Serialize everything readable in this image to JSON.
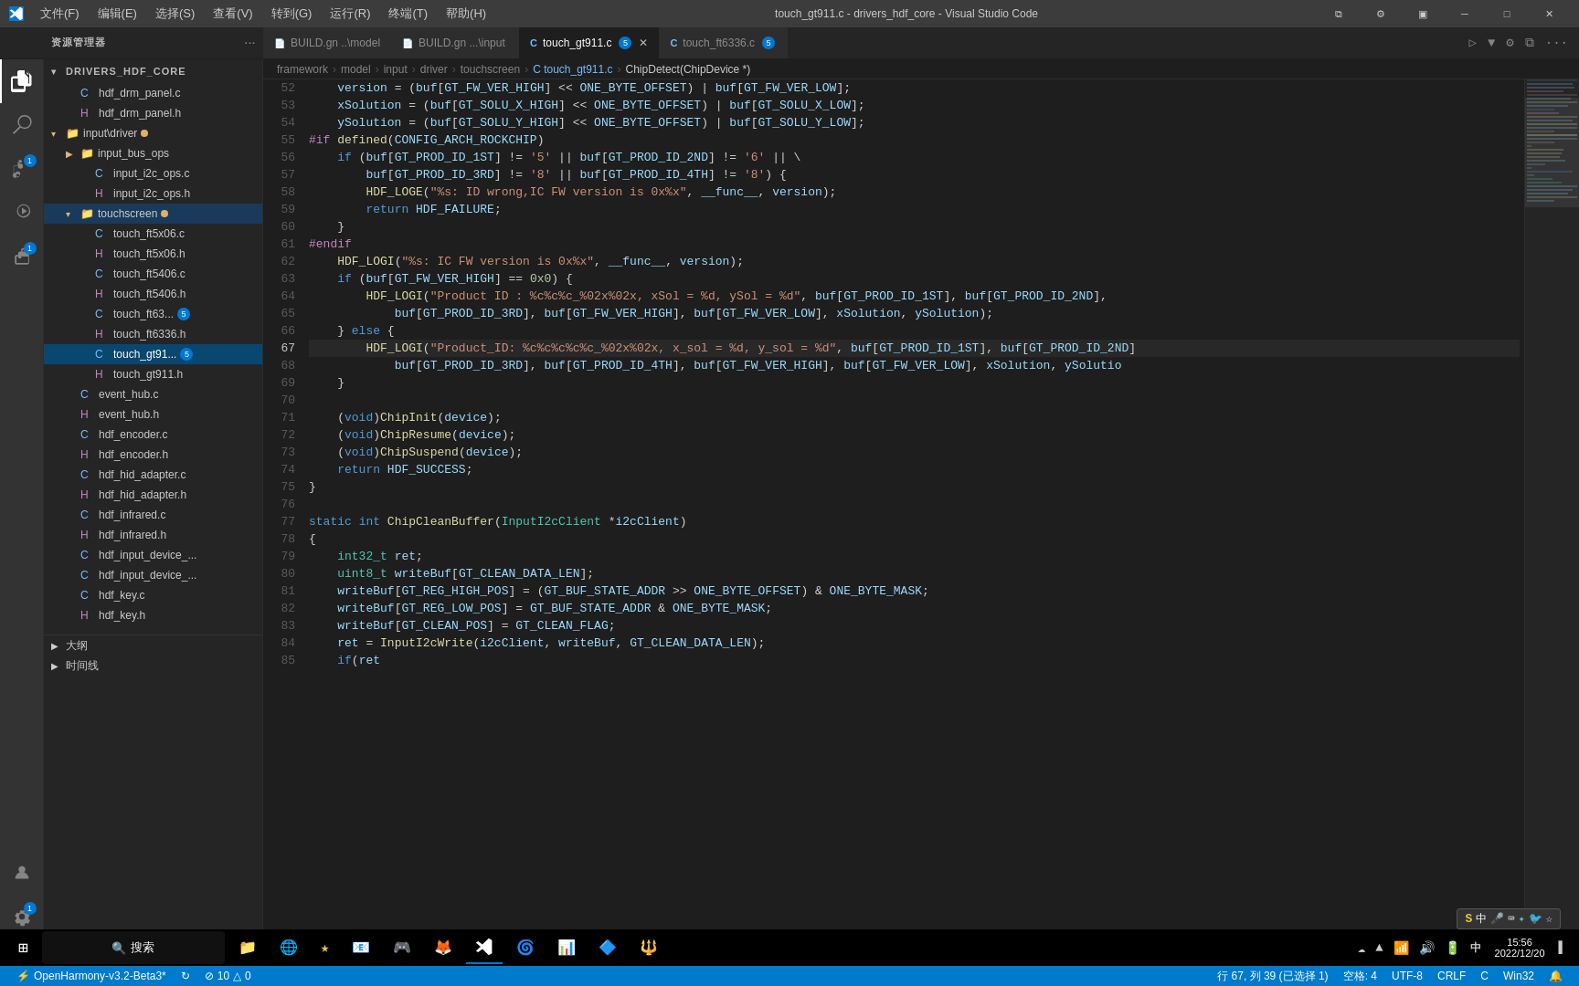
{
  "titlebar": {
    "title": "touch_gt911.c - drivers_hdf_core - Visual Studio Code",
    "icon": "VS",
    "menu": [
      "文件(F)",
      "编辑(E)",
      "选择(S)",
      "查看(V)",
      "转到(G)",
      "运行(R)",
      "终端(T)",
      "帮助(H)"
    ]
  },
  "tabs": [
    {
      "id": "build-gn-model",
      "label": "BUILD.gn  ..\\model",
      "icon": "📄",
      "active": false
    },
    {
      "id": "build-gn-input",
      "label": "BUILD.gn  ...\\input",
      "icon": "📄",
      "active": false
    },
    {
      "id": "touch-gt911",
      "label": "touch_gt911.c",
      "icon": "C",
      "active": true,
      "badge": "5",
      "closable": true
    },
    {
      "id": "touch-ft6336",
      "label": "touch_ft6336.c",
      "icon": "C",
      "active": false,
      "badge": "5",
      "closable": false
    }
  ],
  "breadcrumb": {
    "items": [
      "framework",
      "model",
      "input",
      "driver",
      "touchscreen",
      "C touch_gt911.c",
      "ChipDetect(ChipDevice *)"
    ]
  },
  "sidebar": {
    "title": "资源管理器",
    "root": "DRIVERS_HDF_CORE",
    "tree": [
      {
        "level": 1,
        "type": "folder",
        "name": "hdf_drm_panel.c",
        "indent": 1
      },
      {
        "level": 1,
        "type": "file-h",
        "name": "hdf_drm_panel.h",
        "indent": 1
      },
      {
        "level": 1,
        "type": "folder-open",
        "name": "input\\driver",
        "indent": 1,
        "dot": true
      },
      {
        "level": 2,
        "type": "folder",
        "name": "input_bus_ops",
        "indent": 2
      },
      {
        "level": 2,
        "type": "file-c",
        "name": "input_i2c_ops.c",
        "indent": 2
      },
      {
        "level": 2,
        "type": "file-h",
        "name": "input_i2c_ops.h",
        "indent": 2
      },
      {
        "level": 2,
        "type": "folder-open",
        "name": "touchscreen",
        "indent": 2,
        "dot2": true
      },
      {
        "level": 3,
        "type": "file-c",
        "name": "touch_ft5x06.c",
        "indent": 3
      },
      {
        "level": 3,
        "type": "file-h",
        "name": "touch_ft5x06.h",
        "indent": 3
      },
      {
        "level": 3,
        "type": "file-c",
        "name": "touch_ft5406.c",
        "indent": 3
      },
      {
        "level": 3,
        "type": "file-h",
        "name": "touch_ft5406.h",
        "indent": 3
      },
      {
        "level": 3,
        "type": "file-c",
        "name": "touch_ft63...  5",
        "indent": 3,
        "badge": "5"
      },
      {
        "level": 3,
        "type": "file-h",
        "name": "touch_ft6336.h",
        "indent": 3
      },
      {
        "level": 3,
        "type": "file-c-active",
        "name": "touch_gt91...  5",
        "indent": 3,
        "badge": "5",
        "active": true
      },
      {
        "level": 3,
        "type": "file-h",
        "name": "touch_gt911.h",
        "indent": 3
      },
      {
        "level": 2,
        "type": "file-c",
        "name": "event_hub.c",
        "indent": 2
      },
      {
        "level": 2,
        "type": "file-h",
        "name": "event_hub.h",
        "indent": 2
      },
      {
        "level": 2,
        "type": "file-c",
        "name": "hdf_encoder.c",
        "indent": 2
      },
      {
        "level": 2,
        "type": "file-h",
        "name": "hdf_encoder.h",
        "indent": 2
      },
      {
        "level": 2,
        "type": "file-c",
        "name": "hdf_hid_adapter.c",
        "indent": 2
      },
      {
        "level": 2,
        "type": "file-h",
        "name": "hdf_hid_adapter.h",
        "indent": 2
      },
      {
        "level": 2,
        "type": "file-c",
        "name": "hdf_infrared.c",
        "indent": 2
      },
      {
        "level": 2,
        "type": "file-h",
        "name": "hdf_infrared.h",
        "indent": 2
      },
      {
        "level": 2,
        "type": "file-c",
        "name": "hdf_input_device_...",
        "indent": 2
      },
      {
        "level": 2,
        "type": "file-c",
        "name": "hdf_input_device_...",
        "indent": 2
      },
      {
        "level": 2,
        "type": "file-c",
        "name": "hdf_key.c",
        "indent": 2
      },
      {
        "level": 2,
        "type": "file-h",
        "name": "hdf_key.h",
        "indent": 2
      }
    ],
    "bottom_folders": [
      "大纲",
      "时间线"
    ]
  },
  "code": {
    "lines": [
      {
        "num": 52,
        "content": "    version = (buf[GT_FW_VER_HIGH] << ONE_BYTE_OFFSET) | buf[GT_FW_VER_LOW];"
      },
      {
        "num": 53,
        "content": "    xSolution = (buf[GT_SOLU_X_HIGH] << ONE_BYTE_OFFSET) | buf[GT_SOLU_X_LOW];"
      },
      {
        "num": 54,
        "content": "    ySolution = (buf[GT_SOLU_Y_HIGH] << ONE_BYTE_OFFSET) | buf[GT_SOLU_Y_LOW];"
      },
      {
        "num": 55,
        "content": "#if defined(CONFIG_ARCH_ROCKCHIP)"
      },
      {
        "num": 56,
        "content": "    if (buf[GT_PROD_ID_1ST] != '5' || buf[GT_PROD_ID_2ND] != '6' || \\"
      },
      {
        "num": 57,
        "content": "        buf[GT_PROD_ID_3RD] != '8' || buf[GT_PROD_ID_4TH] != '8') {"
      },
      {
        "num": 58,
        "content": "        HDF_LOGE(\"%s: ID wrong,IC FW version is 0x%x\", __func__, version);"
      },
      {
        "num": 59,
        "content": "        return HDF_FAILURE;"
      },
      {
        "num": 60,
        "content": "    }"
      },
      {
        "num": 61,
        "content": "#endif"
      },
      {
        "num": 62,
        "content": "    HDF_LOGI(\"%s: IC FW version is 0x%x\", __func__, version);"
      },
      {
        "num": 63,
        "content": "    if (buf[GT_FW_VER_HIGH] == 0x0) {"
      },
      {
        "num": 64,
        "content": "        HDF_LOGI(\"Product ID : %c%c%c_%02x%02x, xSol = %d, ySol = %d\", buf[GT_PROD_ID_1ST], buf[GT_PROD_ID_2ND],"
      },
      {
        "num": 65,
        "content": "            buf[GT_PROD_ID_3RD], buf[GT_FW_VER_HIGH], buf[GT_FW_VER_LOW], xSolution, ySolution);"
      },
      {
        "num": 66,
        "content": "    } else {"
      },
      {
        "num": 67,
        "content": "        HDF_LOGI(\"Product_ID: %c%c%c%c%c_%02x%02x, x_sol = %d, y_sol = %d\", buf[GT_PROD_ID_1ST], buf[GT_PROD_ID_2ND]",
        "active": true
      },
      {
        "num": 68,
        "content": "            buf[GT_PROD_ID_3RD], buf[GT_PROD_ID_4TH], buf[GT_FW_VER_HIGH], buf[GT_FW_VER_LOW], xSolution, ySolutio"
      },
      {
        "num": 69,
        "content": "    }"
      },
      {
        "num": 70,
        "content": ""
      },
      {
        "num": 71,
        "content": "    (void)ChipInit(device);"
      },
      {
        "num": 72,
        "content": "    (void)ChipResume(device);"
      },
      {
        "num": 73,
        "content": "    (void)ChipSuspend(device);"
      },
      {
        "num": 74,
        "content": "    return HDF_SUCCESS;"
      },
      {
        "num": 75,
        "content": "}"
      },
      {
        "num": 76,
        "content": ""
      },
      {
        "num": 77,
        "content": "static int ChipCleanBuffer(InputI2cClient *i2cClient)"
      },
      {
        "num": 78,
        "content": "{"
      },
      {
        "num": 79,
        "content": "    int32_t ret;"
      },
      {
        "num": 80,
        "content": "    uint8_t writeBuf[GT_CLEAN_DATA_LEN];"
      },
      {
        "num": 81,
        "content": "    writeBuf[GT_REG_HIGH_POS] = (GT_BUF_STATE_ADDR >> ONE_BYTE_OFFSET) & ONE_BYTE_MASK;"
      },
      {
        "num": 82,
        "content": "    writeBuf[GT_REG_LOW_POS] = GT_BUF_STATE_ADDR & ONE_BYTE_MASK;"
      },
      {
        "num": 83,
        "content": "    writeBuf[GT_CLEAN_POS] = GT_CLEAN_FLAG;"
      },
      {
        "num": 84,
        "content": "    ret = InputI2cWrite(i2cClient, writeBuf, GT_CLEAN_DATA_LEN);"
      },
      {
        "num": 85,
        "content": "    if(ret"
      }
    ]
  },
  "statusbar": {
    "left_items": [
      {
        "icon": "⚡",
        "text": "OpenHarmony-v3.2-Beta3*"
      },
      {
        "icon": "↻",
        "text": ""
      },
      {
        "icon": "⚠",
        "text": "10  △ 0"
      }
    ],
    "right_items": [
      {
        "text": "行 67, 列 39 (已选择 1)"
      },
      {
        "text": "空格: 4"
      },
      {
        "text": "UTF-8"
      },
      {
        "text": "CRLF"
      },
      {
        "text": "C"
      },
      {
        "text": "Win32"
      },
      {
        "icon": "🔔",
        "text": ""
      }
    ]
  },
  "taskbar": {
    "time": "15:56",
    "date": "2022/12/20",
    "apps": [
      "⊞",
      "🔍 搜索"
    ]
  },
  "ime": {
    "label": "S 中 ♪",
    "icons": [
      "🎤",
      "⌨",
      "✦",
      "🐦",
      "☆"
    ]
  }
}
